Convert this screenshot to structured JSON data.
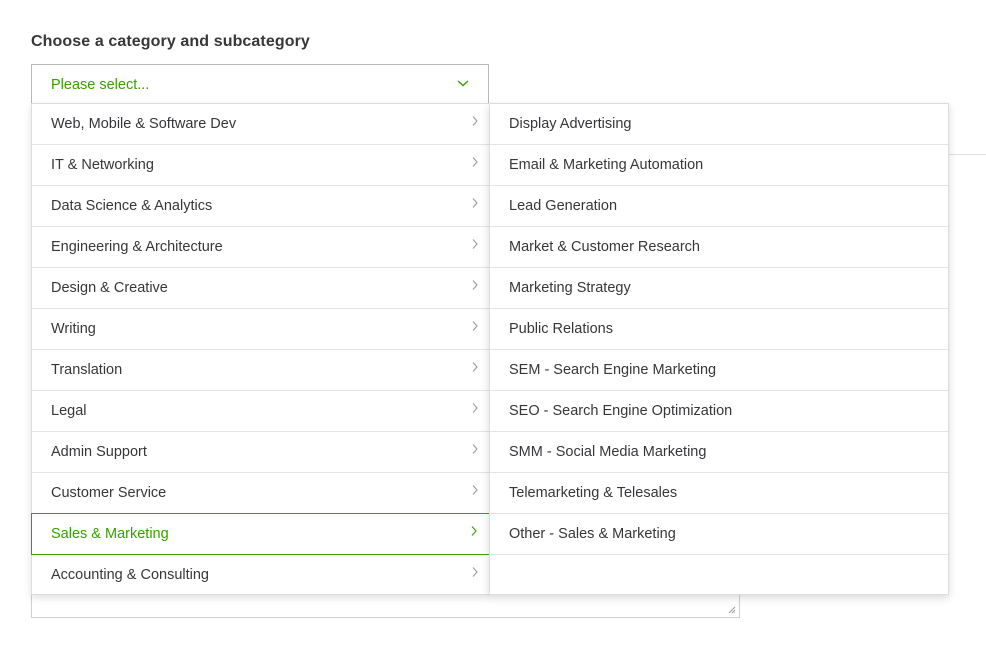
{
  "form": {
    "label": "Choose a category and subcategory",
    "select": {
      "placeholder": "Please select...",
      "icon": "chevron-down-icon"
    }
  },
  "colors": {
    "accent": "#37a000",
    "text": "#37373a",
    "border": "#dcdcdc"
  },
  "categories": [
    {
      "label": "Web, Mobile & Software Dev",
      "active": false
    },
    {
      "label": "IT & Networking",
      "active": false
    },
    {
      "label": "Data Science & Analytics",
      "active": false
    },
    {
      "label": "Engineering & Architecture",
      "active": false
    },
    {
      "label": "Design & Creative",
      "active": false
    },
    {
      "label": "Writing",
      "active": false
    },
    {
      "label": "Translation",
      "active": false
    },
    {
      "label": "Legal",
      "active": false
    },
    {
      "label": "Admin Support",
      "active": false
    },
    {
      "label": "Customer Service",
      "active": false
    },
    {
      "label": "Sales & Marketing",
      "active": true
    },
    {
      "label": "Accounting & Consulting",
      "active": false
    }
  ],
  "subcategories": [
    {
      "label": "Display Advertising"
    },
    {
      "label": "Email & Marketing Automation"
    },
    {
      "label": "Lead Generation"
    },
    {
      "label": "Market & Customer Research"
    },
    {
      "label": "Marketing Strategy"
    },
    {
      "label": "Public Relations"
    },
    {
      "label": "SEM - Search Engine Marketing"
    },
    {
      "label": "SEO - Search Engine Optimization"
    },
    {
      "label": "SMM - Social Media Marketing"
    },
    {
      "label": "Telemarketing & Telesales"
    },
    {
      "label": "Other - Sales & Marketing"
    }
  ]
}
